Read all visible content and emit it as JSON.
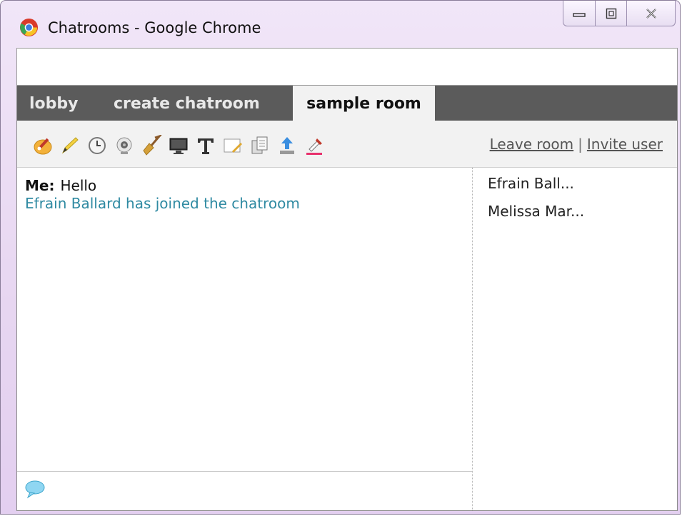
{
  "window": {
    "title": "Chatrooms - Google Chrome",
    "icon": "chrome-icon",
    "controls": [
      "minimize-icon",
      "maximize-icon",
      "close-icon"
    ]
  },
  "address_bar": {
    "value": ""
  },
  "tabs": [
    {
      "label": "lobby",
      "active": false
    },
    {
      "label": "create chatroom",
      "active": false
    },
    {
      "label": "sample room",
      "active": true
    }
  ],
  "toolbar": {
    "tools": [
      "paint-palette-icon",
      "pencil-icon",
      "clock-icon",
      "webcam-icon",
      "broom-icon",
      "monitor-icon",
      "text-icon",
      "notepad-icon",
      "copy-icon",
      "upload-icon",
      "color-picker-icon"
    ],
    "leave_room": "Leave room",
    "separator": "|",
    "invite_user": "Invite user"
  },
  "messages": [
    {
      "sender": "Me:",
      "text": "Hello"
    },
    {
      "system": "Efrain Ballard has joined the chatroom"
    }
  ],
  "users": [
    "Efrain Ball...",
    "Melissa Mar..."
  ],
  "input": {
    "icon": "speech-bubble-icon",
    "value": ""
  },
  "colors": {
    "tabbar": "#5b5b5b",
    "active_tab": "#f2f2f2",
    "system_message": "#2f8aa2",
    "title_gradient": "#e7d6f1"
  }
}
